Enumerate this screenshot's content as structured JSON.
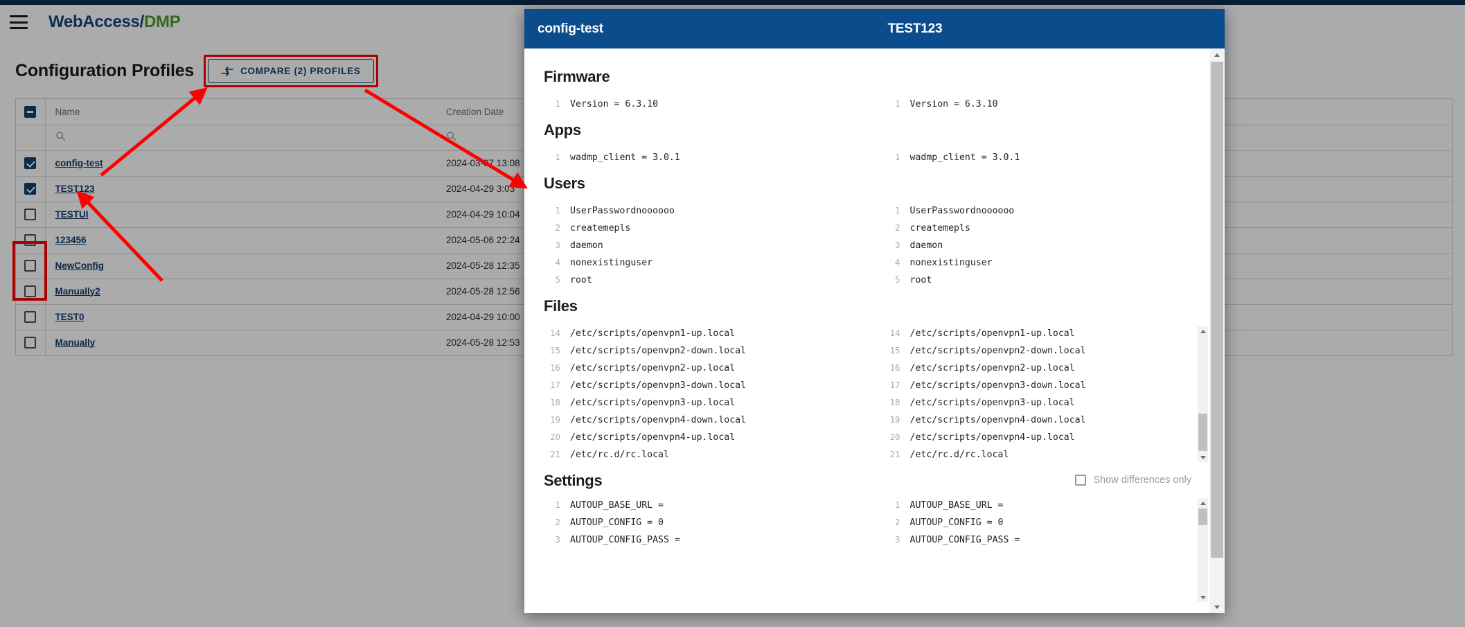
{
  "brand": {
    "part1": "WebAccess",
    "slash": "/",
    "part2": "DMP"
  },
  "header": {
    "menu_icon": "hamburger-icon"
  },
  "page": {
    "title": "Configuration Profiles",
    "compare_button": {
      "label": "COMPARE (2) PROFILES",
      "icon": "compare-arrows-icon"
    }
  },
  "table": {
    "columns": [
      "Name",
      "Creation Date"
    ],
    "select_all_state": "indeterminate",
    "filter_icon": "search-icon",
    "rows": [
      {
        "checked": true,
        "name": "config-test",
        "date": "2024-03-07 13:08"
      },
      {
        "checked": true,
        "name": "TEST123",
        "date": "2024-04-29 3:03"
      },
      {
        "checked": false,
        "name": "TESTUI",
        "date": "2024-04-29 10:04"
      },
      {
        "checked": false,
        "name": "123456",
        "date": "2024-05-06 22:24"
      },
      {
        "checked": false,
        "name": "NewConfig",
        "date": "2024-05-28 12:35"
      },
      {
        "checked": false,
        "name": "Manually2",
        "date": "2024-05-28 12:56"
      },
      {
        "checked": false,
        "name": "TEST0",
        "date": "2024-04-29 10:00"
      },
      {
        "checked": false,
        "name": "Manually",
        "date": "2024-05-28 12:53"
      }
    ]
  },
  "modal": {
    "left_title": "config-test",
    "right_title": "TEST123",
    "show_differences_only": {
      "label": "Show differences only",
      "checked": false
    },
    "sections": [
      {
        "title": "Firmware",
        "left": [
          {
            "n": "1",
            "t": "Version = 6.3.10"
          }
        ],
        "right": [
          {
            "n": "1",
            "t": "Version = 6.3.10"
          }
        ]
      },
      {
        "title": "Apps",
        "left": [
          {
            "n": "1",
            "t": "wadmp_client = 3.0.1"
          }
        ],
        "right": [
          {
            "n": "1",
            "t": "wadmp_client = 3.0.1"
          }
        ]
      },
      {
        "title": "Users",
        "left": [
          {
            "n": "1",
            "t": "UserPasswordnoooooo"
          },
          {
            "n": "2",
            "t": "createmepls"
          },
          {
            "n": "3",
            "t": "daemon"
          },
          {
            "n": "4",
            "t": "nonexistinguser"
          },
          {
            "n": "5",
            "t": "root"
          }
        ],
        "right": [
          {
            "n": "1",
            "t": "UserPasswordnoooooo"
          },
          {
            "n": "2",
            "t": "createmepls"
          },
          {
            "n": "3",
            "t": "daemon"
          },
          {
            "n": "4",
            "t": "nonexistinguser"
          },
          {
            "n": "5",
            "t": "root"
          }
        ]
      },
      {
        "title": "Files",
        "left": [
          {
            "n": "14",
            "t": "/etc/scripts/openvpn1-up.local"
          },
          {
            "n": "15",
            "t": "/etc/scripts/openvpn2-down.local"
          },
          {
            "n": "16",
            "t": "/etc/scripts/openvpn2-up.local"
          },
          {
            "n": "17",
            "t": "/etc/scripts/openvpn3-down.local"
          },
          {
            "n": "18",
            "t": "/etc/scripts/openvpn3-up.local"
          },
          {
            "n": "19",
            "t": "/etc/scripts/openvpn4-down.local"
          },
          {
            "n": "20",
            "t": "/etc/scripts/openvpn4-up.local"
          },
          {
            "n": "21",
            "t": "/etc/rc.d/rc.local"
          }
        ],
        "right": [
          {
            "n": "14",
            "t": "/etc/scripts/openvpn1-up.local"
          },
          {
            "n": "15",
            "t": "/etc/scripts/openvpn2-down.local"
          },
          {
            "n": "16",
            "t": "/etc/scripts/openvpn2-up.local"
          },
          {
            "n": "17",
            "t": "/etc/scripts/openvpn3-down.local"
          },
          {
            "n": "18",
            "t": "/etc/scripts/openvpn3-up.local"
          },
          {
            "n": "19",
            "t": "/etc/scripts/openvpn4-down.local"
          },
          {
            "n": "20",
            "t": "/etc/scripts/openvpn4-up.local"
          },
          {
            "n": "21",
            "t": "/etc/rc.d/rc.local"
          }
        ]
      },
      {
        "title": "Settings",
        "left": [
          {
            "n": "1",
            "t": "AUTOUP_BASE_URL ="
          },
          {
            "n": "2",
            "t": "AUTOUP_CONFIG = 0"
          },
          {
            "n": "3",
            "t": "AUTOUP_CONFIG_PASS ="
          }
        ],
        "right": [
          {
            "n": "1",
            "t": "AUTOUP_BASE_URL ="
          },
          {
            "n": "2",
            "t": "AUTOUP_CONFIG = 0"
          },
          {
            "n": "3",
            "t": "AUTOUP_CONFIG_PASS ="
          }
        ]
      }
    ]
  },
  "colors": {
    "brand_blue": "#15477a",
    "brand_green": "#4c9c2e",
    "modal_header": "#0b4c8c",
    "accent": "#11406e",
    "annotation_red": "#ff0000"
  }
}
